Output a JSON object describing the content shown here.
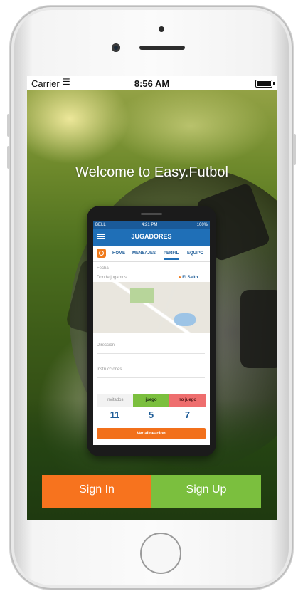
{
  "status_bar": {
    "carrier": "Carrier",
    "time": "8:56 AM"
  },
  "welcome": {
    "title": "Welcome to Easy.Futbol"
  },
  "preview": {
    "status": {
      "carrier": "BELL",
      "time": "4:21 PM",
      "battery": "100%"
    },
    "nav_title": "JUGADORES",
    "tabs": [
      "HOME",
      "MENSAJES",
      "PERFIL",
      "EQUIPO"
    ],
    "active_tab": "PERFIL",
    "fields": {
      "fecha": "Fecha",
      "donde_label": "Donde jugamos",
      "donde_value": "El Salto",
      "direccion": "Dirección",
      "instrucciones": "Instrucciones"
    },
    "counts": {
      "labels": [
        "Invitados",
        "juego",
        "no juego"
      ],
      "values": [
        "11",
        "5",
        "7"
      ]
    },
    "button": "Ver alineacion"
  },
  "actions": {
    "sign_in": "Sign In",
    "sign_up": "Sign Up"
  },
  "colors": {
    "orange": "#f7731e",
    "green": "#7bbf3e",
    "blue": "#1f6fb7"
  }
}
